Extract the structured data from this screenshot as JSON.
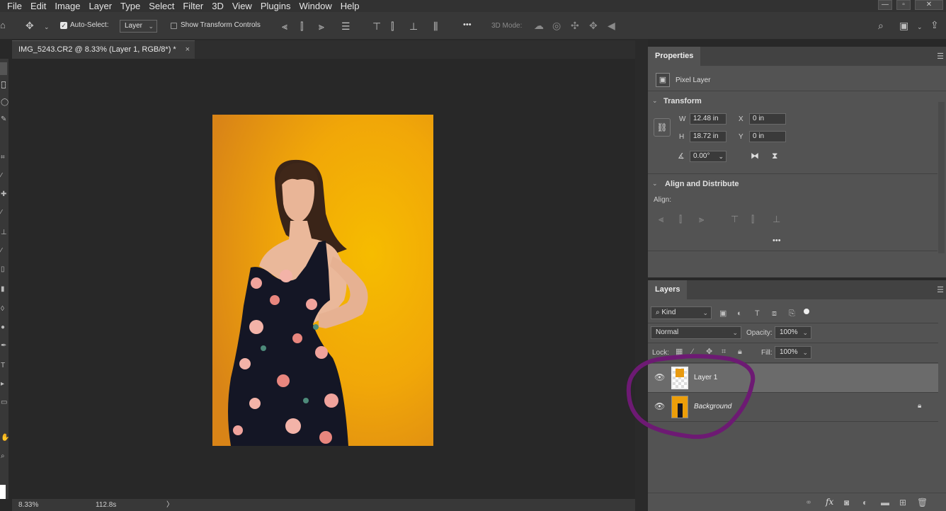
{
  "menubar": {
    "items": [
      "File",
      "Edit",
      "Image",
      "Layer",
      "Type",
      "Select",
      "Filter",
      "3D",
      "View",
      "Plugins",
      "Window",
      "Help"
    ],
    "window_controls": [
      "—",
      "▫",
      "✕"
    ]
  },
  "options": {
    "auto_select_label": "Auto-Select:",
    "auto_select_value": "Layer",
    "transform_controls_label": "Show Transform Controls",
    "more_icon": "•••",
    "mode_3d_label": "3D Mode:"
  },
  "document": {
    "tab_title": "IMG_5243.CR2 @ 8.33% (Layer 1, RGB/8*) *",
    "close": "×"
  },
  "status": {
    "zoom": "8.33%",
    "info": "112.8s",
    "arrow": "〉"
  },
  "properties": {
    "tab": "Properties",
    "layer_type": "Pixel Layer",
    "transform_title": "Transform",
    "w_label": "W",
    "w_value": "12.48 in",
    "h_label": "H",
    "h_value": "18.72 in",
    "x_label": "X",
    "x_value": "0 in",
    "y_label": "Y",
    "y_value": "0 in",
    "angle_value": "0.00°",
    "align_title": "Align and Distribute",
    "align_label": "Align:",
    "more": "•••"
  },
  "layers_panel": {
    "tab": "Layers",
    "filter_kind": "Kind",
    "blend_mode": "Normal",
    "opacity_label": "Opacity:",
    "opacity_value": "100%",
    "lock_label": "Lock:",
    "fill_label": "Fill:",
    "fill_value": "100%",
    "layers": [
      {
        "name": "Layer 1",
        "selected": true
      },
      {
        "name": "Background",
        "selected": false,
        "locked": true
      }
    ],
    "footer_icons": [
      "link-icon",
      "fx-icon",
      "mask-icon",
      "adjustment-icon",
      "folder-icon",
      "new-layer-icon",
      "trash-icon"
    ],
    "fx_label": "fx"
  },
  "colors": {
    "annotation": "#6d1a73",
    "backdrop": "#f2aa06",
    "dress": "#141625"
  }
}
